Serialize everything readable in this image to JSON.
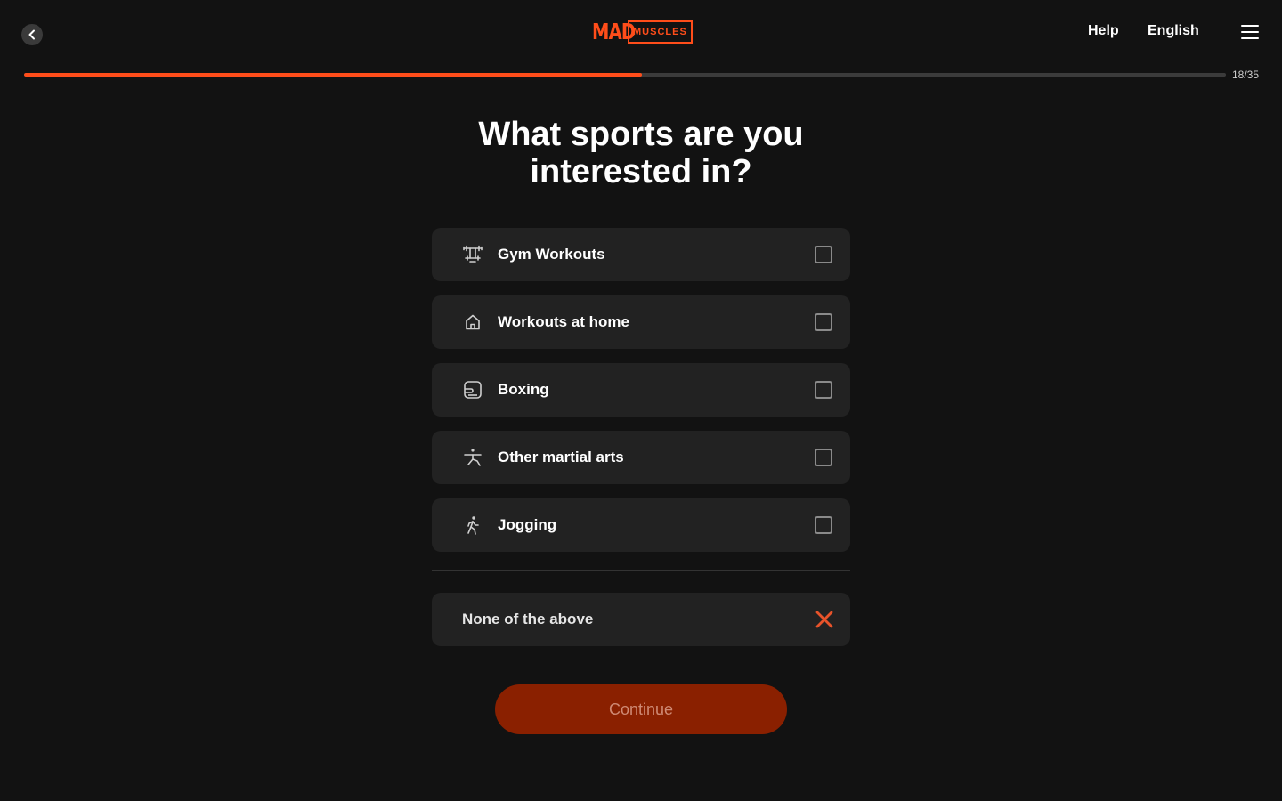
{
  "header": {
    "back_icon": "chevron-left-icon",
    "logo": {
      "mad": "MAD",
      "muscles": "MUSCLES",
      "color": "#ff4d1a"
    },
    "help_label": "Help",
    "language_label": "English",
    "menu_icon": "hamburger-menu-icon"
  },
  "progress": {
    "current": 18,
    "total": 35,
    "label": "18/35",
    "fraction": 0.514,
    "fill_color": "#ff4d1a"
  },
  "question": {
    "title": "What sports are you interested in?"
  },
  "options": [
    {
      "label": "Gym Workouts",
      "icon": "barbell-icon",
      "checked": false
    },
    {
      "label": "Workouts at home",
      "icon": "home-icon",
      "checked": false
    },
    {
      "label": "Boxing",
      "icon": "boxing-glove-icon",
      "checked": false
    },
    {
      "label": "Other martial arts",
      "icon": "martial-arts-icon",
      "checked": false
    },
    {
      "label": "Jogging",
      "icon": "running-icon",
      "checked": false
    }
  ],
  "none_option": {
    "label": "None of the above",
    "icon": "close-icon",
    "icon_color": "#e8532a"
  },
  "continue_button": {
    "label": "Continue",
    "disabled": true,
    "color": "#8a2000"
  }
}
